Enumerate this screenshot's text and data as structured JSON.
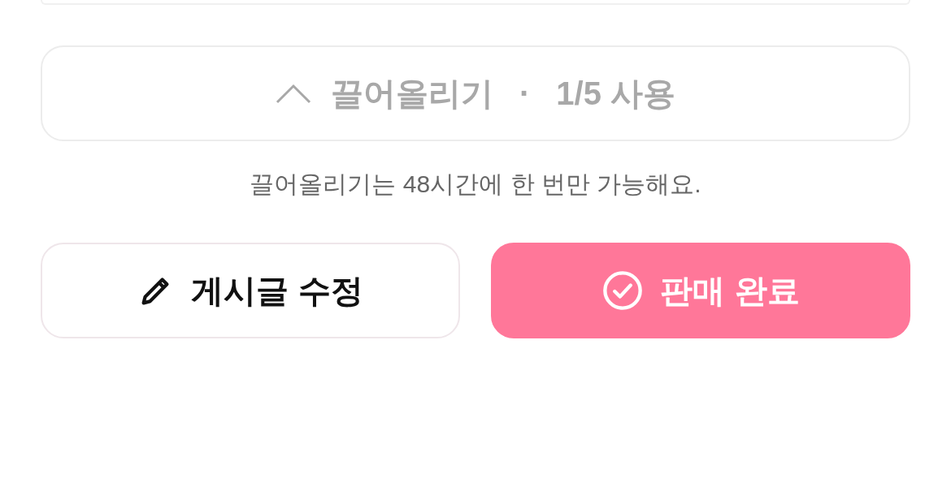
{
  "bump": {
    "label": "끌어올리기",
    "separator": "·",
    "usage": "1/5 사용",
    "disabled": true
  },
  "notice": "끌어올리기는 48시간에 한 번만 가능해요.",
  "buttons": [
    {
      "kind": "edit",
      "label": "게시글 수정"
    },
    {
      "kind": "complete",
      "label": "판매 완료"
    }
  ]
}
